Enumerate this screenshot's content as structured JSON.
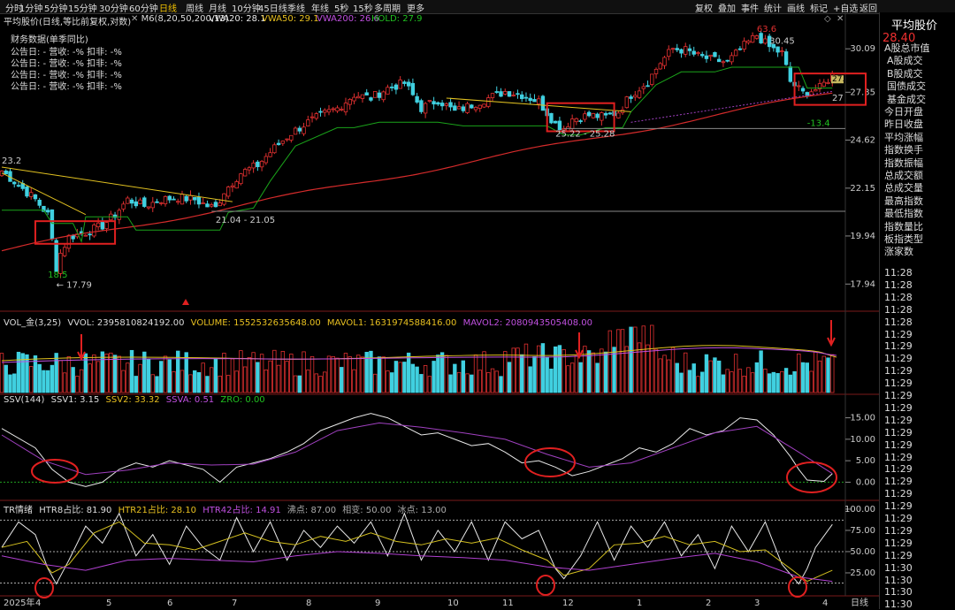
{
  "toolbar": {
    "left_items": [
      "分时",
      "1分钟",
      "5分钟",
      "15分钟",
      "30分钟",
      "60分钟",
      "日线",
      "周线",
      "月线",
      "10分钟",
      "45日线",
      "季线",
      "年线",
      "5秒",
      "15秒",
      "多周期",
      "更多"
    ],
    "active": "日线",
    "right_items": [
      "复权",
      "叠加",
      "事件",
      "统计",
      "画线",
      "标记",
      "+自选",
      "返回"
    ]
  },
  "title_bar": {
    "name": "平均股价(日线,等比前复权,对数)",
    "ma_label": "M6(8,20,50,200,13)",
    "vwa20": "VWA20: 28.1",
    "vwa50": "VWA50: 29.1",
    "vwa200": "VWA200: 26.6",
    "hold": "HOLD: 27.9"
  },
  "finance": {
    "title": "财务数据(单季同比)",
    "rows": [
      "公告日: -  营收: -%  扣非: -%",
      "公告日: -  营收: -%  扣非: -%",
      "公告日: -  营收: -%  扣非: -%",
      "公告日: -  营收: -%  扣非: -%"
    ]
  },
  "right_panel": {
    "title": "平均股价",
    "price": "28.40",
    "items": [
      "A股总市值",
      "A股成交",
      "B股成交",
      "国债成交",
      "基金成交",
      "今日开盘",
      "昨日收盘",
      "平均涨幅",
      "指数换手",
      "指数振幅",
      "总成交额",
      "总成交量",
      "最高指数",
      "最低指数",
      "指数量比",
      "板指类型",
      "涨家数"
    ],
    "times": [
      "11:28",
      "11:28",
      "11:28",
      "11:28",
      "11:28",
      "11:29",
      "11:29",
      "11:29",
      "11:29",
      "11:29",
      "11:29",
      "11:29",
      "11:29",
      "11:29",
      "11:29",
      "11:29",
      "11:29",
      "11:29",
      "11:29",
      "11:29",
      "11:29",
      "11:29",
      "11:29",
      "11:29",
      "11:30",
      "11:30",
      "11:30",
      "11:30"
    ]
  },
  "chart_data": [
    {
      "type": "candlestick",
      "title": "平均股价(日线,等比前复权,对数)",
      "y_ticks": [
        30.09,
        27.35,
        24.62,
        22.15,
        19.94,
        17.94
      ],
      "ylim": [
        17.3,
        31.6
      ],
      "log_scale": true,
      "close_path": [
        [
          0,
          23.0
        ],
        [
          4,
          22.3
        ],
        [
          8,
          21.6
        ],
        [
          11,
          20.9
        ],
        [
          13,
          18.6
        ],
        [
          14,
          19.2
        ],
        [
          16,
          19.9
        ],
        [
          20,
          20.1
        ],
        [
          24,
          20.4
        ],
        [
          27,
          20.9
        ],
        [
          30,
          21.6
        ],
        [
          34,
          21.3
        ],
        [
          38,
          21.6
        ],
        [
          42,
          21.7
        ],
        [
          46,
          21.6
        ],
        [
          49,
          21.3
        ],
        [
          51,
          21.2
        ],
        [
          53,
          22.0
        ],
        [
          57,
          22.9
        ],
        [
          61,
          23.3
        ],
        [
          65,
          24.2
        ],
        [
          69,
          25.0
        ],
        [
          73,
          25.6
        ],
        [
          77,
          26.1
        ],
        [
          80,
          26.4
        ],
        [
          84,
          27.2
        ],
        [
          88,
          27.0
        ],
        [
          92,
          27.6
        ],
        [
          96,
          27.9
        ],
        [
          100,
          26.4
        ],
        [
          104,
          26.9
        ],
        [
          108,
          26.2
        ],
        [
          112,
          26.6
        ],
        [
          116,
          27.0
        ],
        [
          120,
          27.4
        ],
        [
          124,
          27.2
        ],
        [
          128,
          26.8
        ],
        [
          132,
          25.5
        ],
        [
          134,
          25.3
        ],
        [
          136,
          25.8
        ],
        [
          140,
          26.0
        ],
        [
          144,
          25.9
        ],
        [
          147,
          26.2
        ],
        [
          150,
          27.2
        ],
        [
          154,
          28.0
        ],
        [
          157,
          29.2
        ],
        [
          160,
          30.1
        ],
        [
          163,
          30.0
        ],
        [
          166,
          29.6
        ],
        [
          169,
          29.4
        ],
        [
          173,
          29.2
        ],
        [
          177,
          30.3
        ],
        [
          180,
          31.0
        ],
        [
          183,
          30.2
        ],
        [
          186,
          29.8
        ],
        [
          188,
          28.0
        ],
        [
          191,
          27.3
        ],
        [
          195,
          27.6
        ],
        [
          198,
          28.4
        ]
      ],
      "annotations": [
        "23.2",
        "18.5",
        "17.79",
        "21.04 - 21.05",
        "25.22 - 25.28",
        "63.6",
        "30.45",
        "27.1",
        "27",
        "-13.4"
      ],
      "series": [
        {
          "name": "VWA20",
          "color": "#1aa31a"
        },
        {
          "name": "VWA200",
          "color": "#d42b2b"
        }
      ]
    },
    {
      "type": "bar",
      "title": "VOL_金(3,25)",
      "legend": [
        "VVOL: 2395810824192.00",
        "VOLUME: 1552532635648.00",
        "MAVOL1: 1631974588416.00",
        "MAVOL2: 2080943505408.00"
      ]
    },
    {
      "type": "line",
      "title": "SSV(144)",
      "legend": [
        "SSV1: 3.15",
        "SSV2: 33.32",
        "SSVA: 0.51",
        "ZRO: 0.00"
      ],
      "y_ticks": [
        15.0,
        10.0,
        5.0,
        0.0
      ],
      "ylim": [
        -3,
        18
      ],
      "series": [
        {
          "name": "SSV1",
          "color": "#e8e8e8",
          "x": [
            0,
            8,
            12,
            16,
            20,
            24,
            28,
            32,
            36,
            40,
            44,
            48,
            52,
            56,
            60,
            64,
            68,
            72,
            76,
            80,
            84,
            88,
            92,
            96,
            100,
            104,
            108,
            112,
            116,
            120,
            124,
            128,
            132,
            136,
            140,
            144,
            148,
            152,
            156,
            160,
            164,
            168,
            172,
            176,
            180,
            184,
            188,
            190,
            192,
            196,
            198
          ],
          "values": [
            12.5,
            8,
            3,
            0,
            -1,
            0,
            3,
            4.5,
            3.5,
            5,
            4,
            3,
            0,
            3.5,
            4.5,
            5.5,
            7,
            9,
            12,
            13.5,
            15,
            16,
            15,
            13,
            11,
            11.5,
            10,
            8.5,
            9,
            7,
            4.5,
            5,
            3.5,
            1.5,
            2.5,
            4,
            5.5,
            8,
            7,
            9,
            12.5,
            11,
            12,
            15,
            14.5,
            11,
            6,
            3,
            0.5,
            0.2,
            2
          ]
        },
        {
          "name": "SSVA",
          "color": "#a040c0",
          "x": [
            0,
            10,
            20,
            30,
            40,
            50,
            60,
            70,
            80,
            90,
            100,
            110,
            120,
            130,
            140,
            150,
            160,
            170,
            180,
            190,
            198
          ],
          "values": [
            11,
            5,
            1.8,
            2.8,
            4.5,
            4,
            4.2,
            7,
            12,
            13.8,
            12.8,
            11.5,
            10,
            6.5,
            3.5,
            4.5,
            8,
            11.5,
            13,
            7,
            2
          ]
        }
      ]
    },
    {
      "type": "line",
      "title": "TR情绪",
      "legend": [
        "HTR8占比: 81.90",
        "HTR21占比: 28.10",
        "HTR42占比: 14.91",
        "沸点: 87.00",
        "相变: 50.00",
        "冰点: 13.00"
      ],
      "y_ticks": [
        100.0,
        75.0,
        50.0,
        25.0
      ],
      "ylim": [
        0,
        102
      ],
      "x_labels": [
        "2025年",
        "4",
        "5",
        "6",
        "7",
        "8",
        "9",
        "10",
        "11",
        "12",
        "1",
        "2",
        "3",
        "4",
        "日线"
      ],
      "series": [
        {
          "name": "HTR8占比",
          "color": "#e8e8e8",
          "x": [
            0,
            4,
            8,
            11,
            13,
            16,
            20,
            24,
            28,
            32,
            36,
            40,
            44,
            48,
            52,
            56,
            60,
            64,
            68,
            72,
            76,
            80,
            84,
            88,
            92,
            96,
            100,
            104,
            108,
            112,
            116,
            120,
            124,
            128,
            132,
            134,
            138,
            142,
            146,
            150,
            154,
            158,
            162,
            166,
            170,
            174,
            178,
            182,
            186,
            190,
            192,
            194,
            198
          ],
          "values": [
            55,
            85,
            70,
            30,
            12,
            40,
            80,
            60,
            95,
            45,
            70,
            35,
            80,
            55,
            40,
            90,
            50,
            85,
            40,
            75,
            55,
            80,
            60,
            85,
            45,
            95,
            40,
            75,
            50,
            85,
            40,
            85,
            65,
            75,
            30,
            18,
            45,
            85,
            40,
            80,
            55,
            85,
            45,
            70,
            30,
            80,
            50,
            85,
            35,
            12,
            30,
            55,
            82
          ]
        },
        {
          "name": "HTR21占比",
          "color": "#d4c020",
          "x": [
            0,
            6,
            12,
            16,
            22,
            28,
            34,
            40,
            46,
            52,
            58,
            64,
            70,
            76,
            82,
            88,
            94,
            100,
            106,
            112,
            118,
            124,
            130,
            134,
            140,
            146,
            152,
            158,
            164,
            170,
            176,
            182,
            188,
            192,
            198
          ],
          "values": [
            55,
            62,
            25,
            35,
            72,
            85,
            60,
            58,
            52,
            62,
            72,
            62,
            58,
            68,
            62,
            72,
            62,
            58,
            65,
            60,
            66,
            52,
            40,
            22,
            30,
            58,
            60,
            68,
            58,
            62,
            50,
            52,
            30,
            15,
            28
          ]
        },
        {
          "name": "HTR42占比",
          "color": "#b040d0",
          "x": [
            0,
            10,
            20,
            30,
            40,
            50,
            60,
            70,
            80,
            90,
            100,
            110,
            120,
            130,
            140,
            150,
            160,
            170,
            180,
            190,
            198
          ],
          "values": [
            45,
            35,
            28,
            40,
            42,
            40,
            38,
            45,
            50,
            48,
            45,
            43,
            40,
            32,
            28,
            35,
            42,
            48,
            38,
            20,
            15
          ]
        }
      ]
    }
  ]
}
